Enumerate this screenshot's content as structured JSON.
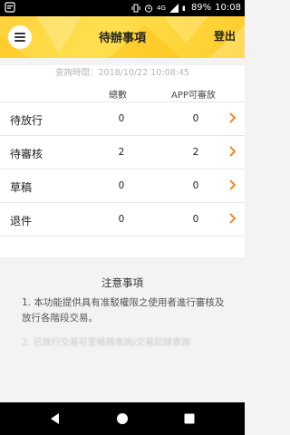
{
  "status_bar": {
    "battery": "89%",
    "time": "10:08",
    "network": "4G"
  },
  "header": {
    "title": "待辦事項",
    "logout_label": "登出",
    "accent_color": "#ffd23c"
  },
  "query_time": "查詢時間：2018/10/22 10:08:45",
  "table": {
    "columns": [
      "總數",
      "APP可審放"
    ],
    "rows": [
      {
        "label": "待放行",
        "total": "0",
        "app_approvable": "0"
      },
      {
        "label": "待審核",
        "total": "2",
        "app_approvable": "2"
      },
      {
        "label": "草稿",
        "total": "0",
        "app_approvable": "0"
      },
      {
        "label": "退件",
        "total": "0",
        "app_approvable": "0"
      }
    ],
    "chevron_color": "#f08a24"
  },
  "notes": {
    "title": "注意事項",
    "items": [
      "1. 本功能提供具有准駁權限之使用者進行審核及放行各階段交易。",
      "2. 已放行交易可至帳務查詢/交易記錄查詢"
    ]
  },
  "nav": {
    "back_icon": "back-triangle-icon",
    "home_icon": "home-circle-icon",
    "recents_icon": "recents-square-icon"
  }
}
